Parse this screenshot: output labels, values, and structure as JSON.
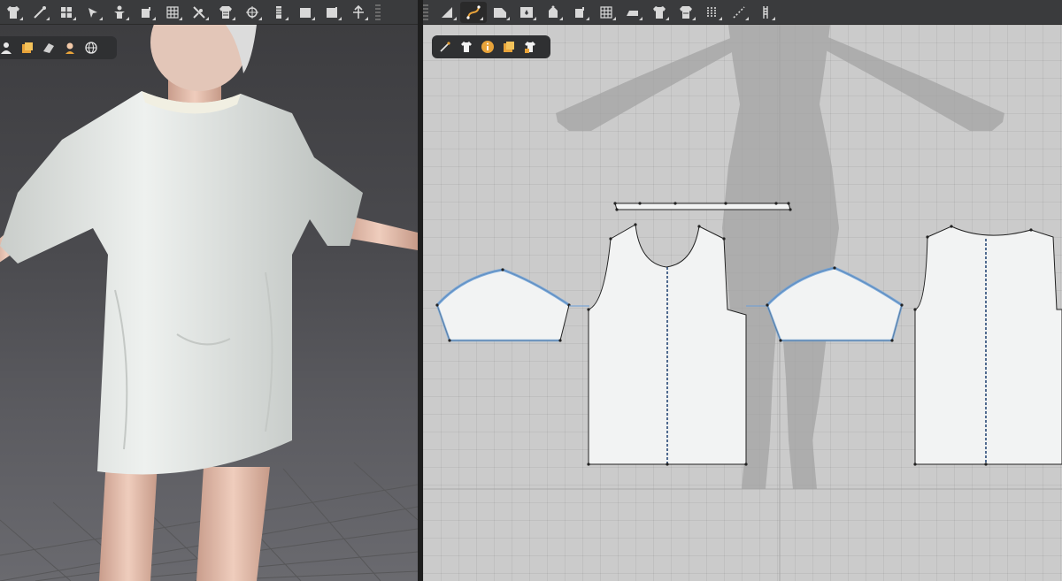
{
  "app": {
    "toolbar_3d": {
      "tools": [
        "tshirt-tool-icon",
        "pen-tool-icon",
        "arrange-avatar-icon",
        "select-mesh-icon",
        "avatar-pose-icon",
        "pin-icon",
        "grid-mesh-icon",
        "tack-icon",
        "fold-icon",
        "point-move-icon",
        "zipper-icon",
        "box-icon",
        "flatten-icon",
        "gizmo-icon"
      ]
    },
    "toolbar_2d": {
      "tools": [
        "edit-pattern-icon",
        "curve-point-icon",
        "polygon-icon",
        "internal-shape-icon",
        "sewing-pattern-icon",
        "pin-2d-icon",
        "grid-2d-icon",
        "iron-icon",
        "tshirt-2d-icon",
        "fold-2d-icon",
        "segment-icon",
        "measure-icon",
        "zipper-2d-icon"
      ],
      "active_tool": "curve-point-icon"
    },
    "mini_toolbar_3d": [
      "avatar-view-icon",
      "texture-view-icon",
      "shade-view-icon",
      "skin-view-icon",
      "globe-view-icon"
    ],
    "mini_toolbar_2d": [
      "pencil-icon",
      "tshirt-view-icon",
      "info-icon",
      "texture-2d-icon",
      "lock-shirt-icon"
    ],
    "colors": {
      "toolbar_bg": "#3a3b3d",
      "canvas_2d_bg": "#cbcbcb",
      "pattern_fill": "#f2f3f3",
      "seam_highlight": "#6a9fd8",
      "active_accent": "#e8a33a"
    }
  }
}
